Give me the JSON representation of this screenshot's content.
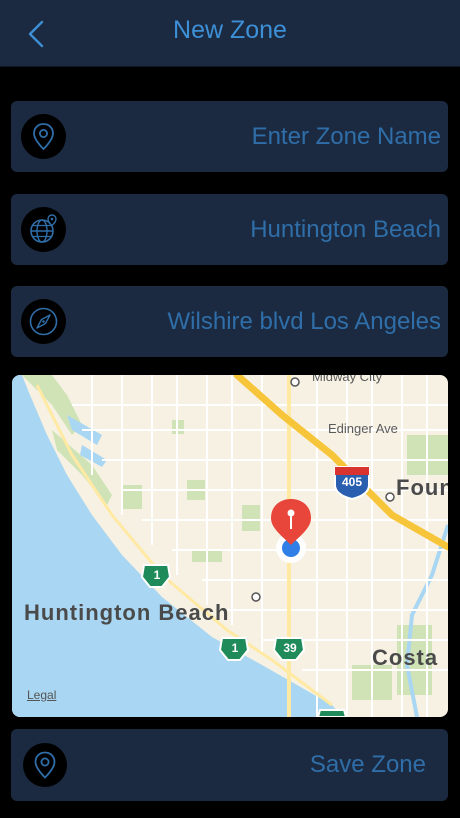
{
  "header": {
    "title": "New Zone",
    "back_icon": "chevron-left-icon"
  },
  "fields": [
    {
      "icon": "location-pin-icon",
      "value": "",
      "placeholder": "Enter Zone Name"
    },
    {
      "icon": "globe-pin-icon",
      "value": "Huntington Beach",
      "placeholder": ""
    },
    {
      "icon": "compass-icon",
      "value": "Wilshire blvd Los Angeles",
      "placeholder": ""
    }
  ],
  "map": {
    "labels": {
      "midway_city": "Midway City",
      "edinger": "Edinger Ave",
      "fountain": "Foun",
      "huntington": "Huntington Beach",
      "costa": "Costa"
    },
    "shields": {
      "i405": "405",
      "route1_a": "1",
      "route1_b": "1",
      "route39": "39"
    },
    "legal": "Legal",
    "pin_color": "#e8463a",
    "location_dot_color": "#2f7fe6"
  },
  "save": {
    "label": "Save Zone",
    "icon": "location-pin-icon"
  },
  "colors": {
    "background": "#000000",
    "panel": "#1b2a40",
    "accent": "#3d8fd6",
    "field_text": "#2f6ea8"
  }
}
